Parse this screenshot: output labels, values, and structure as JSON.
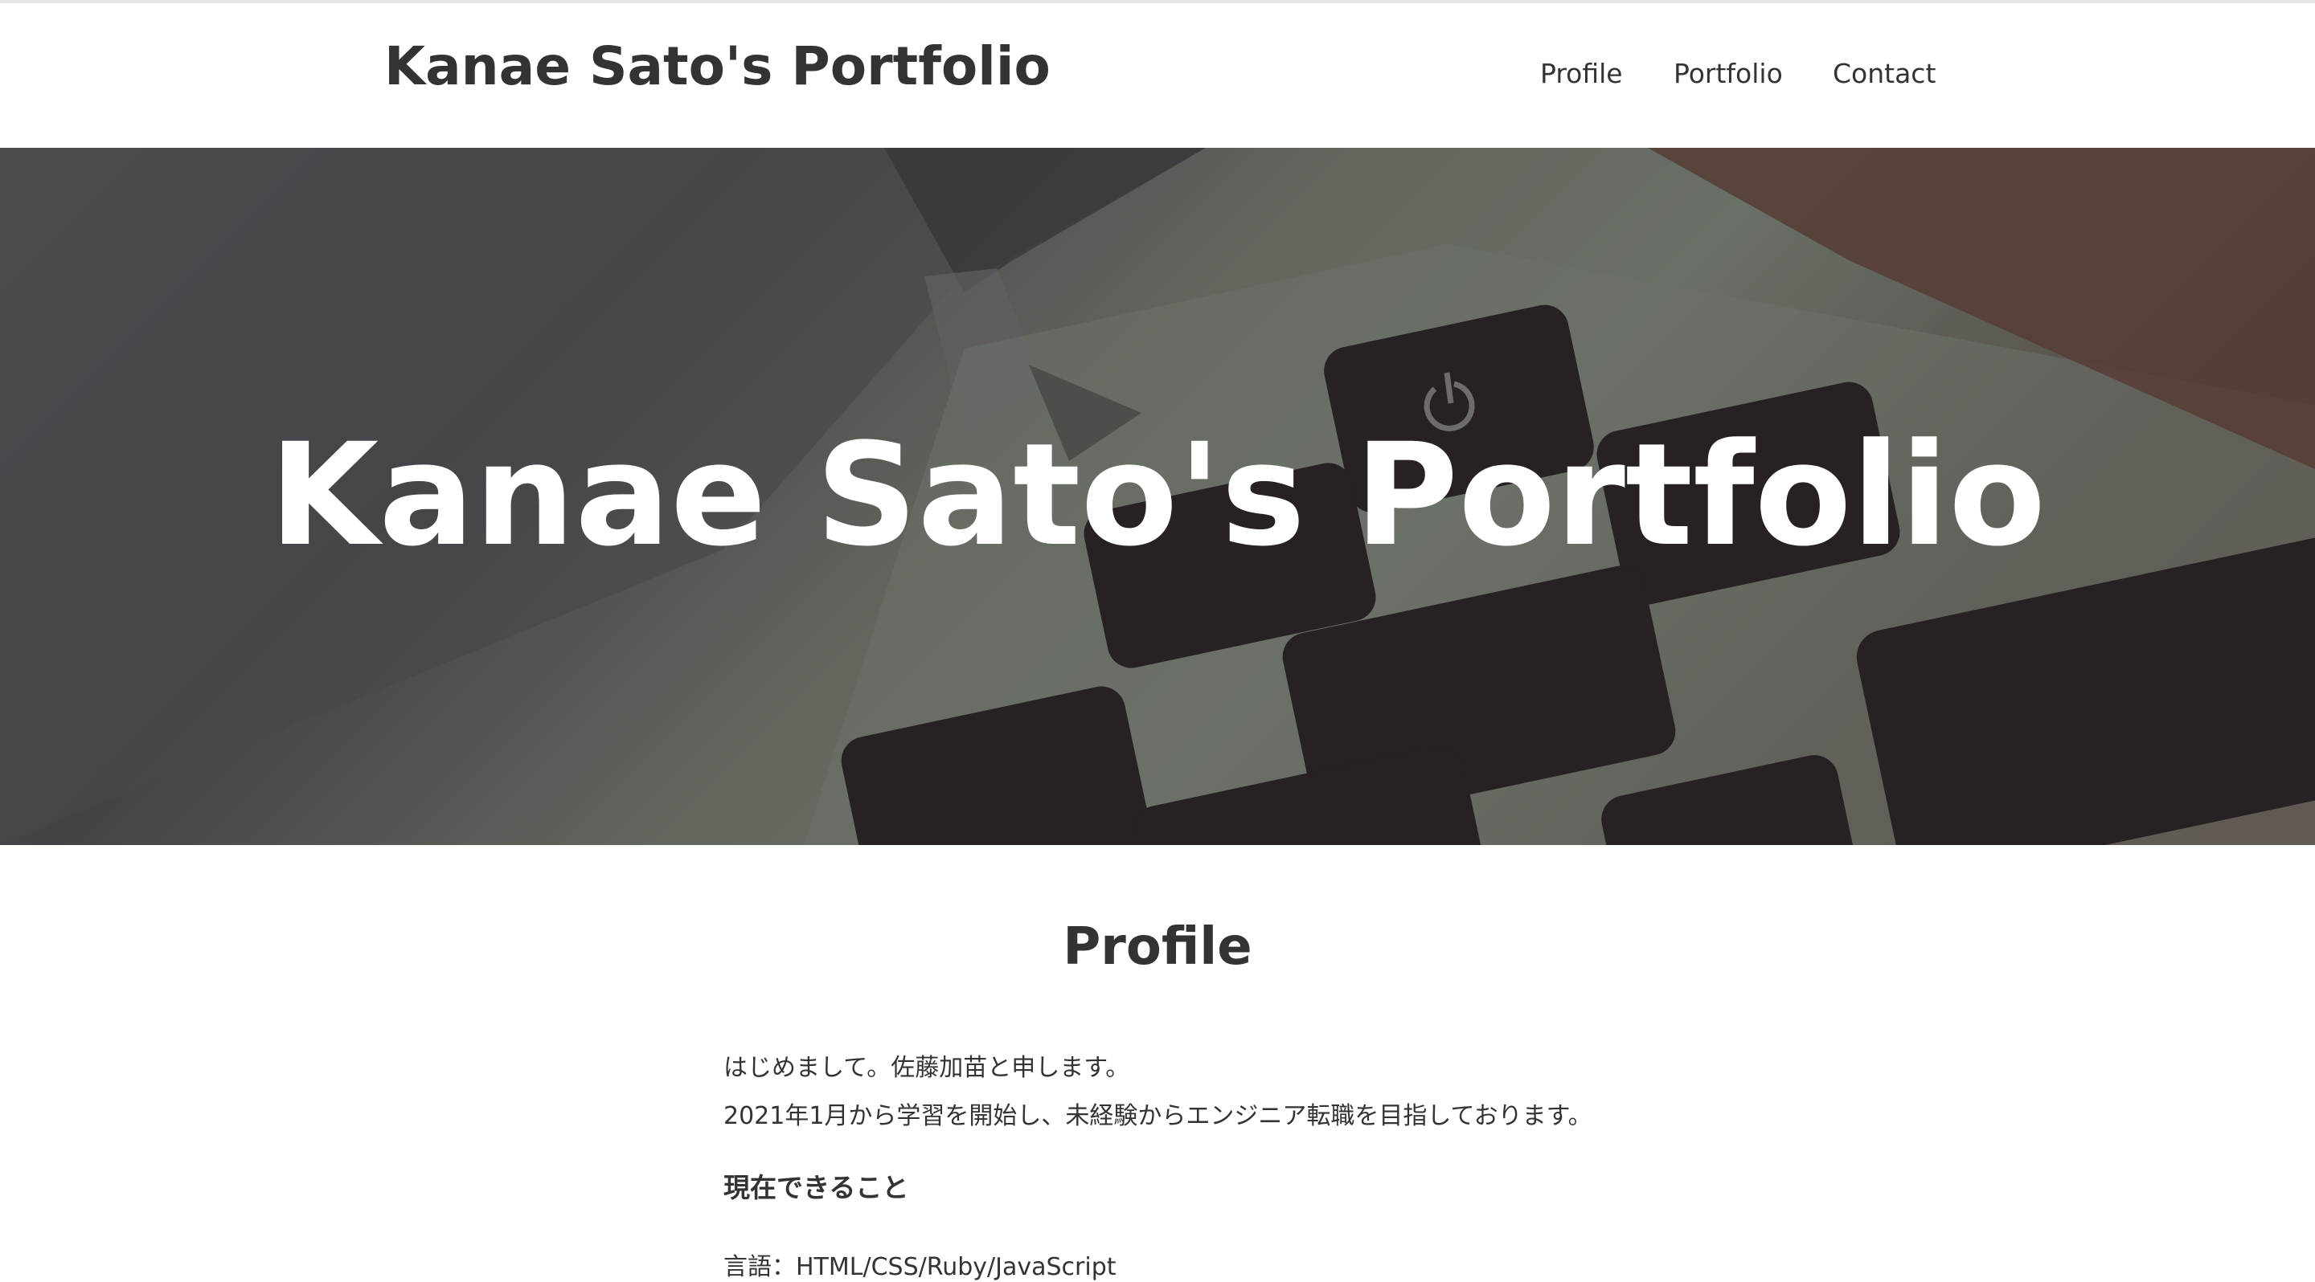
{
  "header": {
    "site_title": "Kanae Sato's Portfolio",
    "nav": [
      {
        "label": "Profile"
      },
      {
        "label": "Portfolio"
      },
      {
        "label": "Contact"
      }
    ]
  },
  "hero": {
    "title": "Kanae Sato's Portfolio",
    "background": "keyboard-photo"
  },
  "profile": {
    "heading": "Profile",
    "intro_lines": [
      "はじめまして。佐藤加苗と申します。",
      "2021年1月から学習を開始し、未経験からエンジニア転職を目指しております。"
    ],
    "subheading": "現在できること",
    "skills_line": "言語：HTML/CSS/Ruby/JavaScript"
  },
  "colors": {
    "text": "#333333",
    "hero_text": "#ffffff",
    "background": "#ffffff"
  }
}
